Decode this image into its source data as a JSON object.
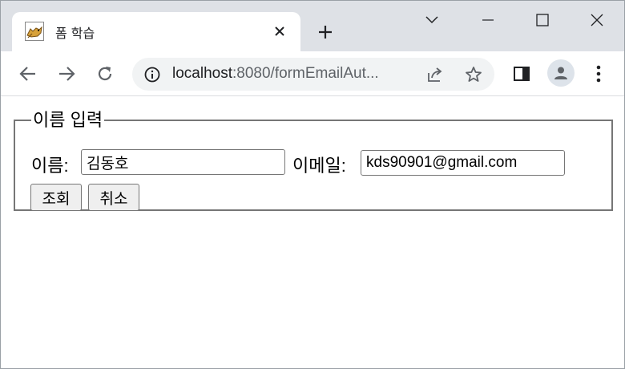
{
  "browser": {
    "tab": {
      "title": "폼 학습",
      "favicon": "tomcat-favicon-icon",
      "close": "close-tab-icon"
    },
    "new_tab": "plus-icon",
    "window_controls": [
      "chevron-down-icon",
      "minimize-icon",
      "maximize-icon",
      "close-window-icon"
    ],
    "toolbar": {
      "back": "back-arrow-icon",
      "forward": "forward-arrow-icon",
      "reload": "reload-icon",
      "url_host": "localhost",
      "url_rest": ":8080/formEmailAut...",
      "share": "share-icon",
      "bookmark": "star-icon",
      "side_panel": "side-panel-icon",
      "profile": "profile-avatar-icon",
      "menu": "kebab-menu-icon"
    }
  },
  "form": {
    "legend": "이름 입력",
    "name_label": "이름:",
    "name_value": "김동호",
    "email_label": "이메일:",
    "email_value": "kds90901@gmail.com",
    "submit_label": "조회",
    "reset_label": "취소"
  },
  "colors": {
    "tabstrip": "#dee1e6",
    "omnibox": "#f1f3f4",
    "icon": "#5f6368",
    "fieldset_border": "#767676",
    "button_bg": "#efefef"
  }
}
